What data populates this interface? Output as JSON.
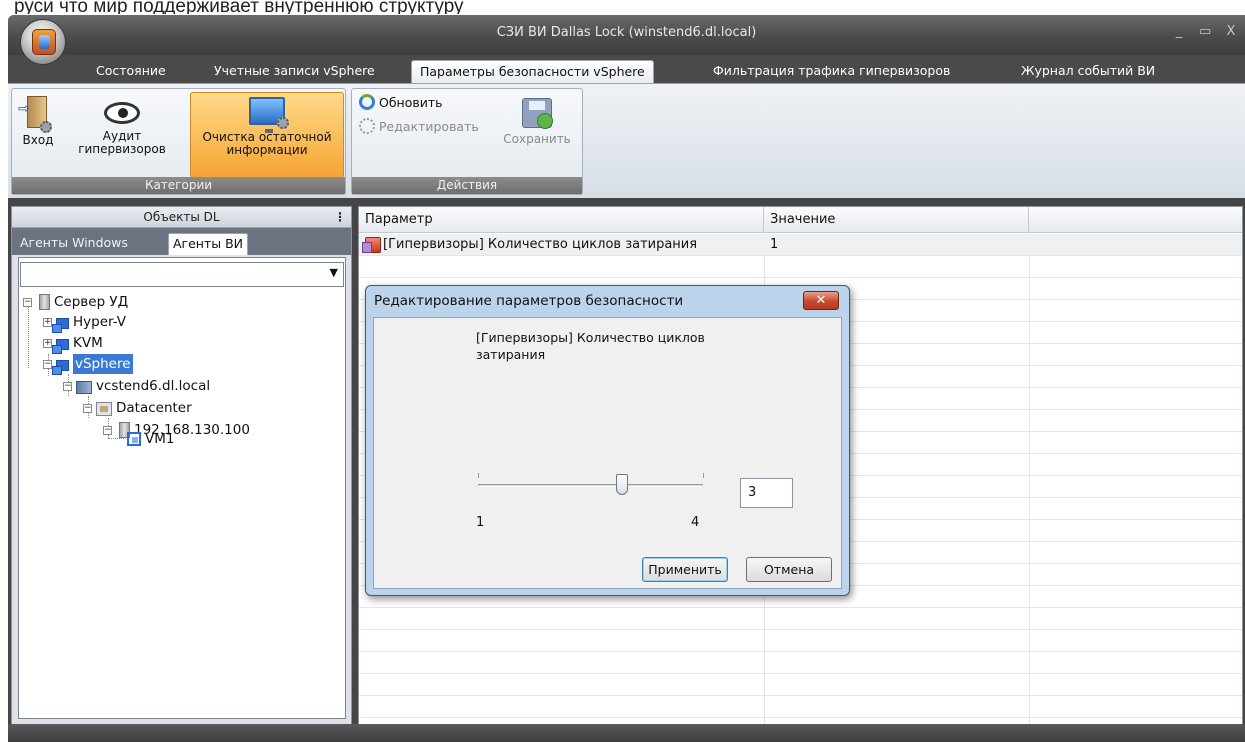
{
  "caption": "руси что мир поддерживает внутреннюю структуру",
  "window": {
    "title": "СЗИ ВИ Dallas Lock (winstend6.dl.local)",
    "controls": [
      "_",
      "▭",
      "X"
    ]
  },
  "tabs": [
    {
      "label": "Состояние"
    },
    {
      "label": "Учетные записи vSphere"
    },
    {
      "label": "Параметры безопасности vSphere",
      "active": true
    },
    {
      "label": "Фильтрация трафика гипервизоров"
    },
    {
      "label": "Журнал событий ВИ"
    }
  ],
  "ribbon": {
    "categories": {
      "label": "Категории",
      "buttons": [
        {
          "label": "Вход",
          "icon": "door-gear-icon"
        },
        {
          "label": "Аудит гипервизоров",
          "icon": "eye-gear-icon"
        },
        {
          "label": "Очистка остаточной информации",
          "icon": "screen-brush-icon",
          "selected": true
        }
      ]
    },
    "actions": {
      "label": "Действия",
      "refresh": "Обновить",
      "edit": "Редактировать",
      "save": "Сохранить"
    }
  },
  "leftpane": {
    "title": "Объекты DL",
    "tabs": [
      "Агенты Windows",
      "Агенты ВИ"
    ],
    "combo_value": "",
    "tree": [
      {
        "label": "Сервер УД",
        "icon": "server-icon"
      },
      {
        "label": "Hyper-V",
        "icon": "cluster-icon"
      },
      {
        "label": "KVM",
        "icon": "cluster-icon"
      },
      {
        "label": "vSphere",
        "icon": "cluster-icon",
        "selected": true
      },
      {
        "label": "vcstend6.dl.local",
        "icon": "host-icon"
      },
      {
        "label": "Datacenter",
        "icon": "datacenter-icon"
      },
      {
        "label": "192.168.130.100",
        "icon": "server-icon"
      },
      {
        "label": "VM1",
        "icon": "vm-icon"
      }
    ]
  },
  "grid": {
    "columns": [
      "Параметр",
      "Значение"
    ],
    "rows": [
      {
        "param": "[Гипервизоры] Количество циклов затирания",
        "value": "1"
      }
    ]
  },
  "dialog": {
    "title": "Редактирование параметров безопасности",
    "description": "[Гипервизоры] Количество циклов затирания",
    "slider": {
      "min": "1",
      "max": "4",
      "value": 3
    },
    "input_value": "3",
    "apply": "Применить",
    "cancel": "Отмена"
  }
}
